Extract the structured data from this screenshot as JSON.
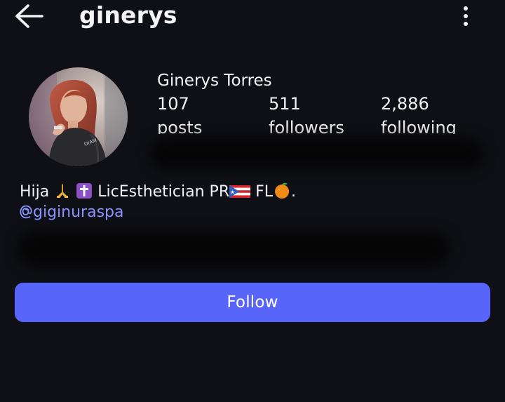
{
  "header": {
    "username": "ginerys",
    "back_icon": "arrow-left-icon",
    "more_icon": "more-vertical-icon"
  },
  "profile": {
    "display_name": "Ginerys Torres",
    "avatar_icon": "profile-photo",
    "stats": [
      {
        "value": "107",
        "label": "posts"
      },
      {
        "value": "511",
        "label": "followers"
      },
      {
        "value": "2,886",
        "label": "following"
      }
    ],
    "bio": {
      "word_1": "Hija",
      "emoji_1": "folded-hands-emoji",
      "emoji_2": "latin-cross-emoji",
      "text_2": "LicEsthetician PR",
      "emoji_3": "puerto-rico-flag-emoji",
      "text_3": "FL",
      "emoji_4": "orange-emoji",
      "text_4": "."
    },
    "threads_handle": "giginuraspa",
    "threads_icon": "threads-at-icon"
  },
  "actions": {
    "follow_label": "Follow"
  },
  "colors": {
    "background": "#0f1015",
    "follow_button": "#5865fb",
    "link": "#8a93ff",
    "text": "#f2f2f4"
  }
}
